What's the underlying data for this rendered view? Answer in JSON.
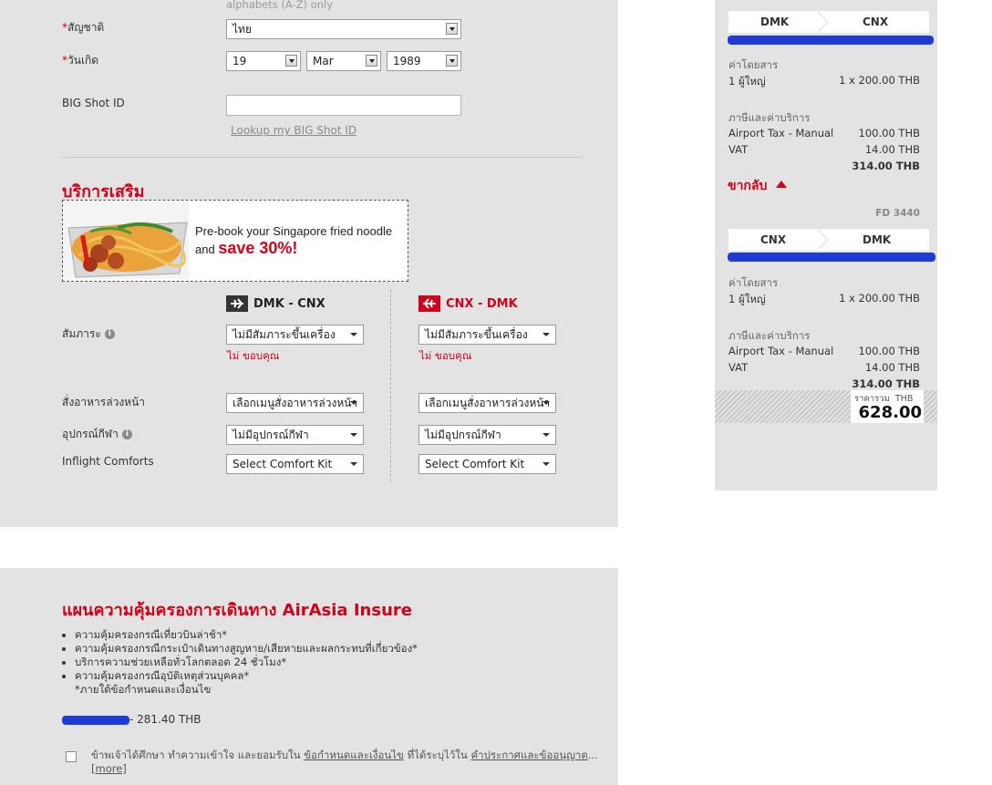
{
  "form": {
    "alphabets_note": "alphabets (A-Z) only",
    "nationality_label": "สัญชาติ",
    "nationality_value": "ไทย",
    "dob_label": "วันเกิด",
    "dob_day": "19",
    "dob_month": "Mar",
    "dob_year": "1989",
    "bigshot_label": "BIG Shot ID",
    "bigshot_lookup": "Lookup my BIG Shot ID",
    "required_mark": "*"
  },
  "addons": {
    "title": "บริการเสริม",
    "promo_line1": "Pre-book your Singapore fried noodle",
    "promo_and": "and",
    "promo_save": "save 30%!",
    "outbound_route": "DMK - CNX",
    "return_route": "CNX - DMK",
    "baggage_label": "สัมภาระ",
    "meal_label": "สั่งอาหารล่วงหน้า",
    "sports_label": "อุปกรณ์กีฬา",
    "comfort_label": "Inflight Comforts",
    "baggage_value": "ไม่มีสัมภาระขึ้นเครื่อง",
    "baggage_note": "ไม่ ขอบคุณ",
    "meal_value": "เลือกเมนูสั่งอาหารล่วงหน้า",
    "sports_value": "ไม่มีอุปกรณ์กีฬา",
    "comfort_value": "Select Comfort Kit"
  },
  "insure": {
    "title": "แผนความคุ้มครองการเดินทาง AirAsia Insure",
    "bullets": [
      "ความคุ้มครองกรณีเที่ยวบินล่าช้า*",
      "ความคุ้มครองกรณีกระเป๋าเดินทางสูญหาย/เสียหายและผลกระทบที่เกี่ยวข้อง*",
      "บริการความช่วยเหลือทั่วโลกตลอด 24 ชั่วโมง*",
      "ความคุ้มครองกรณีอุบัติเหตุส่วนบุคคล*"
    ],
    "footnote": "*ภายใต้ข้อกำหนดและเงื่อนไข",
    "price": "- 281.40 THB",
    "agree_prefix": "ข้าพเจ้าได้ศึกษา ทำความเข้าใจ และยอมรับใน",
    "agree_link1": "ข้อกำหนดและเงื่อนไข",
    "agree_mid": "ที่ได้ระบุไว้ใน",
    "agree_link2": "คำประกาศและข้ออนุญาต",
    "agree_ellipsis": "...",
    "more": "[more]"
  },
  "summary": {
    "out_from": "DMK",
    "out_to": "CNX",
    "fare_label": "ค่าโดยสาร",
    "pax": "1 ผู้ใหญ่",
    "pax_price": "1 x 200.00 THB",
    "tax_label": "ภาษีและค่าบริการ",
    "airport_tax": "Airport Tax - Manual",
    "airport_tax_val": "100.00 THB",
    "vat": "VAT",
    "vat_val": "14.00 THB",
    "subtotal": "314.00 THB",
    "return_label": "ขากลับ",
    "flight_no": "FD 3440",
    "ret_from": "CNX",
    "ret_to": "DMK",
    "total_label": "ราคารวม",
    "total_currency": "THB",
    "total_value": "628.00"
  },
  "colors": {
    "accent": "#d0021b",
    "panel": "#e3e3e3",
    "scribble": "#1f3bd6"
  }
}
